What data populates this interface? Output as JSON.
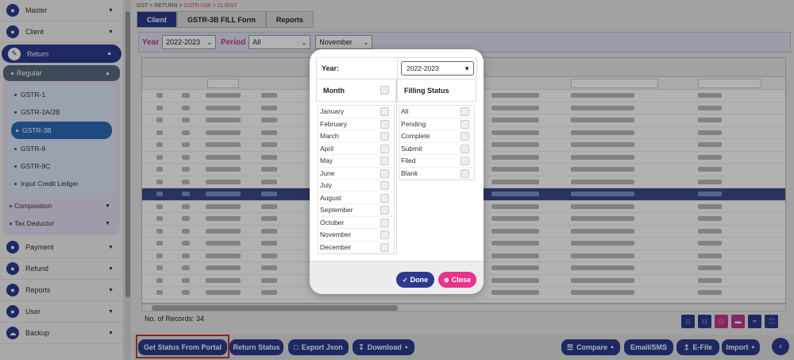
{
  "sidebar": {
    "items_top": [
      {
        "label": "Master",
        "icon": "users-icon"
      },
      {
        "label": "Client",
        "icon": "user-icon"
      }
    ],
    "active": {
      "label": "Return"
    },
    "regular": {
      "label": "Regular",
      "subitems": [
        "GSTR-1",
        "GSTR-2A/2B",
        "GSTR-3B",
        "GSTR-9",
        "GSTR-9C",
        "Input Credit Ledger"
      ],
      "active_index": 2
    },
    "groups": [
      "Composition",
      "Tax Deductor"
    ],
    "items_bottom": [
      {
        "label": "Payment"
      },
      {
        "label": "Refund"
      },
      {
        "label": "Reports"
      },
      {
        "label": "User"
      },
      {
        "label": "Backup"
      }
    ]
  },
  "breadcrumb": {
    "path": "GST > RETURN > ",
    "current": "GSTR-03B > CLIENT"
  },
  "tabs": [
    "Client",
    "GSTR-3B FILL Form",
    "Reports"
  ],
  "filters": {
    "year_label": "Year",
    "year_value": "2022-2023",
    "period_label": "Period",
    "period_value": "All",
    "month_value": "November"
  },
  "grid": {
    "records_label": "No. of Records: 34"
  },
  "bottom_buttons": {
    "get_status": "Get Status From Portal",
    "return_status": "Return Status",
    "export_json": "Export Json",
    "download": "Download",
    "compare": "Compare",
    "email_sms": "Email/SMS",
    "efile": "E-File",
    "import": "Import"
  },
  "modal": {
    "year_label": "Year:",
    "year_value": "2022-2023",
    "month_header": "Month",
    "months": [
      "January",
      "February",
      "March",
      "April",
      "May",
      "June",
      "July",
      "August",
      "September",
      "October",
      "November",
      "December"
    ],
    "status_header": "Filling Status",
    "statuses": [
      "All",
      "Pending",
      "Complete",
      "Submit",
      "Filed",
      "Blank"
    ],
    "done_label": "Done",
    "close_label": "Close"
  },
  "colors": {
    "primary": "#2c3a8e",
    "accent": "#c0398f",
    "close": "#e6358c"
  }
}
